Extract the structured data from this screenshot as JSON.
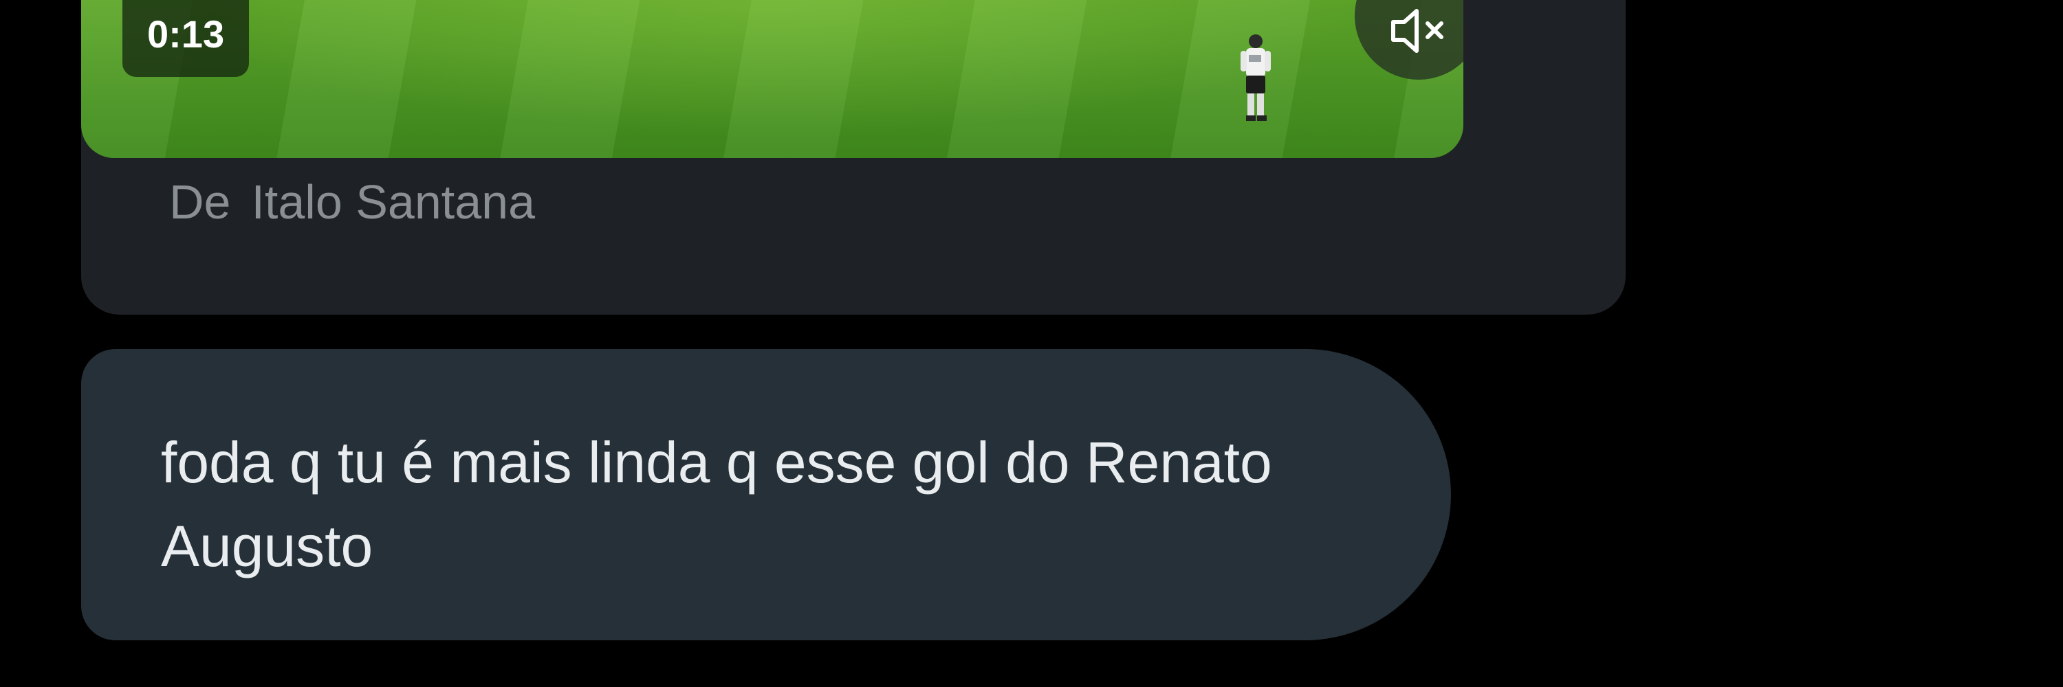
{
  "shared_post": {
    "video": {
      "duration": "0:13",
      "mute_icon": "speaker-muted-icon",
      "field_color": "#4f9a24"
    },
    "from_prefix": "De",
    "author_name": "Italo Santana"
  },
  "message": {
    "text": "foda q tu é mais linda q esse gol do Renato Augusto"
  },
  "colors": {
    "background": "#000000",
    "card": "#1e2226",
    "bubble": "#253038",
    "muted_text": "#8a8f94",
    "message_text": "#e9edef"
  }
}
